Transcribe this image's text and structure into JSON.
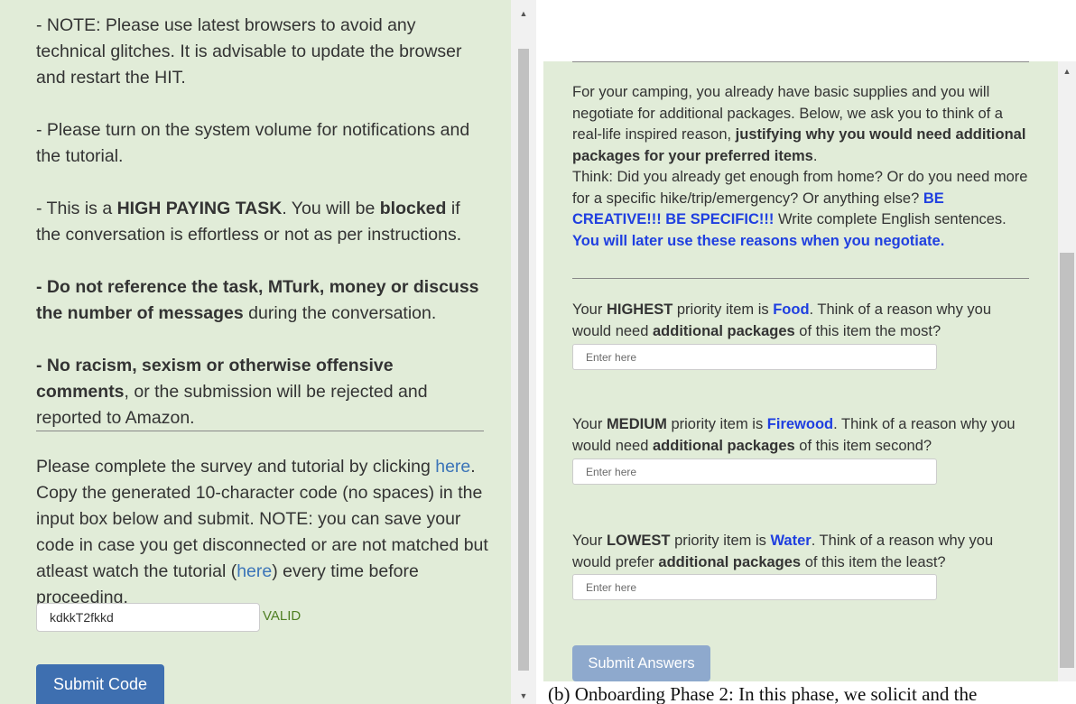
{
  "left": {
    "note1": "- NOTE: Please use latest browsers to avoid any technical glitches. It is advisable to update the browser and restart the HIT.",
    "note2": "- Please turn on the system volume for notifications and the tutorial.",
    "note3": {
      "a": "- This is a ",
      "b": "HIGH PAYING TASK",
      "c": ". You will be ",
      "d": "blocked",
      "e": " if the conversation is effortless or not as per instructions."
    },
    "note4": {
      "bold": "- Do not reference the task, MTurk, money or discuss the number of messages",
      "rest": " during the conversation."
    },
    "note5": {
      "bold": "- No racism, sexism or otherwise offensive comments",
      "rest": ", or the submission will be rejected and reported to Amazon."
    },
    "instructions": {
      "p1": "Please complete the survey and tutorial by clicking ",
      "link1": "here",
      "p2": ". Copy the generated 10-character code (no spaces) in the input box below and submit. NOTE: you can save your code in case you get disconnected or are not matched but atleast watch the tutorial (",
      "link2": "here",
      "p3": ") every time before proceeding."
    },
    "code_value": "kdkkT2fkkd",
    "valid_label": "VALID",
    "submit_label": "Submit Code"
  },
  "right": {
    "intro": {
      "a": "For your camping, you already have basic supplies and you will negotiate for additional packages. Below, we ask you to think of a real-life inspired reason, ",
      "b": "justifying why you would need additional packages for your preferred items",
      "c": ".",
      "d": "Think: Did you already get enough from home? Or do you need more for a specific hike/trip/emergency? Or anything else? ",
      "e": "BE CREATIVE!!! BE SPECIFIC!!!",
      "f": " Write complete English sentences. ",
      "g": "You will later use these reasons when you negotiate."
    },
    "questions": [
      {
        "p1": "Your ",
        "level": "HIGHEST",
        "p2": " priority item is ",
        "item": "Food",
        "p3": ". Think of a reason why you would need ",
        "pkg": "additional packages",
        "p4": " of this item the most?",
        "placeholder": "Enter here"
      },
      {
        "p1": "Your ",
        "level": "MEDIUM",
        "p2": " priority item is ",
        "item": "Firewood",
        "p3": ". Think of a reason why you would need ",
        "pkg": "additional packages",
        "p4": " of this item second?",
        "placeholder": "Enter here"
      },
      {
        "p1": "Your ",
        "level": "LOWEST",
        "p2": " priority item is ",
        "item": "Water",
        "p3": ". Think of a reason why you would prefer ",
        "pkg": "additional packages",
        "p4": " of this item the least?",
        "placeholder": "Enter here"
      }
    ],
    "submit_label": "Submit Answers"
  },
  "caption": "(b) Onboarding Phase 2: In this phase, we solicit and the"
}
